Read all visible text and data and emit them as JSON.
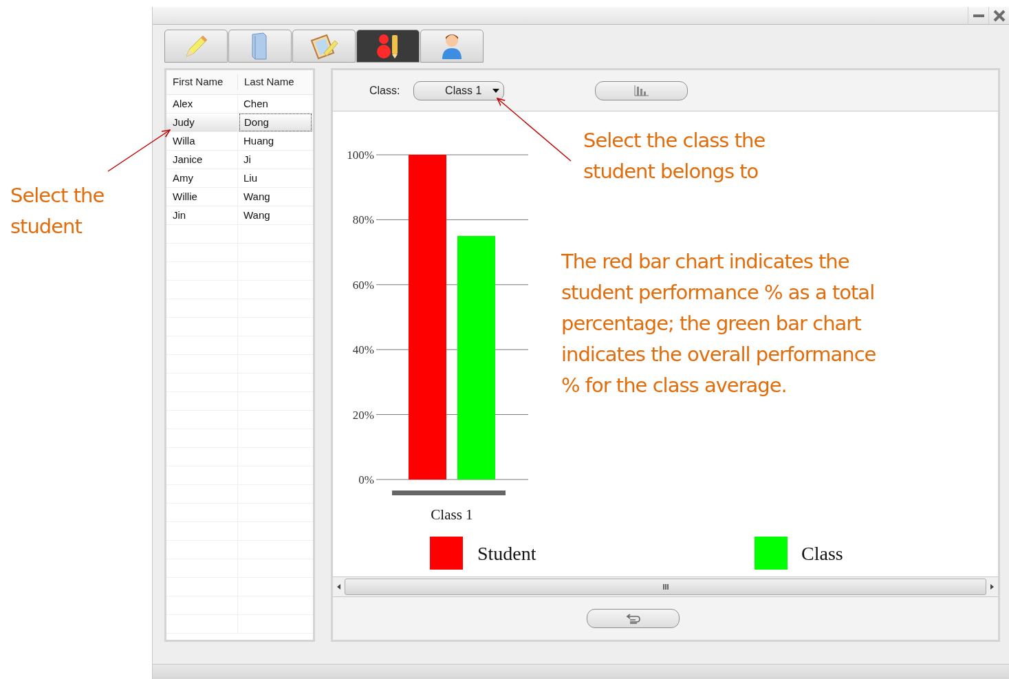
{
  "tabs": [
    {
      "selected": false
    },
    {
      "selected": false
    },
    {
      "selected": false
    },
    {
      "selected": true
    },
    {
      "selected": false
    }
  ],
  "student_table": {
    "columns": [
      "First Name",
      "Last Name"
    ],
    "rows": [
      {
        "first_name": "Alex",
        "last_name": "Chen",
        "selected": false
      },
      {
        "first_name": "Judy",
        "last_name": "Dong",
        "selected": true
      },
      {
        "first_name": "Willa",
        "last_name": "Huang",
        "selected": false
      },
      {
        "first_name": "Janice",
        "last_name": "Ji",
        "selected": false
      },
      {
        "first_name": "Amy",
        "last_name": "Liu",
        "selected": false
      },
      {
        "first_name": "Willie",
        "last_name": "Wang",
        "selected": false
      },
      {
        "first_name": "Jin",
        "last_name": "Wang",
        "selected": false
      }
    ]
  },
  "class_selector": {
    "label": "Class:",
    "value": "Class 1"
  },
  "chart": {
    "chart_data": {
      "type": "bar",
      "categories": [
        "Class 1"
      ],
      "series": [
        {
          "name": "Student",
          "color": "#ff0000",
          "values": [
            100
          ]
        },
        {
          "name": "Class",
          "color": "#00ff00",
          "values": [
            75
          ]
        }
      ],
      "ylim": [
        0,
        100
      ],
      "grid": true,
      "legend": true,
      "yticks": [
        {
          "value": 0,
          "label": "0%"
        },
        {
          "value": 20,
          "label": "20%"
        },
        {
          "value": 40,
          "label": "40%"
        },
        {
          "value": 60,
          "label": "60%"
        },
        {
          "value": 80,
          "label": "80%"
        },
        {
          "value": 100,
          "label": "100%"
        }
      ]
    }
  },
  "callouts": [
    {
      "lines": [
        "Select the",
        "student"
      ]
    },
    {
      "lines": [
        "Select the class the",
        "student belongs to"
      ]
    },
    {
      "lines": [
        "The red bar chart indicates the",
        "student performance % as a total",
        "percentage; the green bar chart",
        "indicates the overall performance",
        "% for the class average."
      ]
    }
  ]
}
